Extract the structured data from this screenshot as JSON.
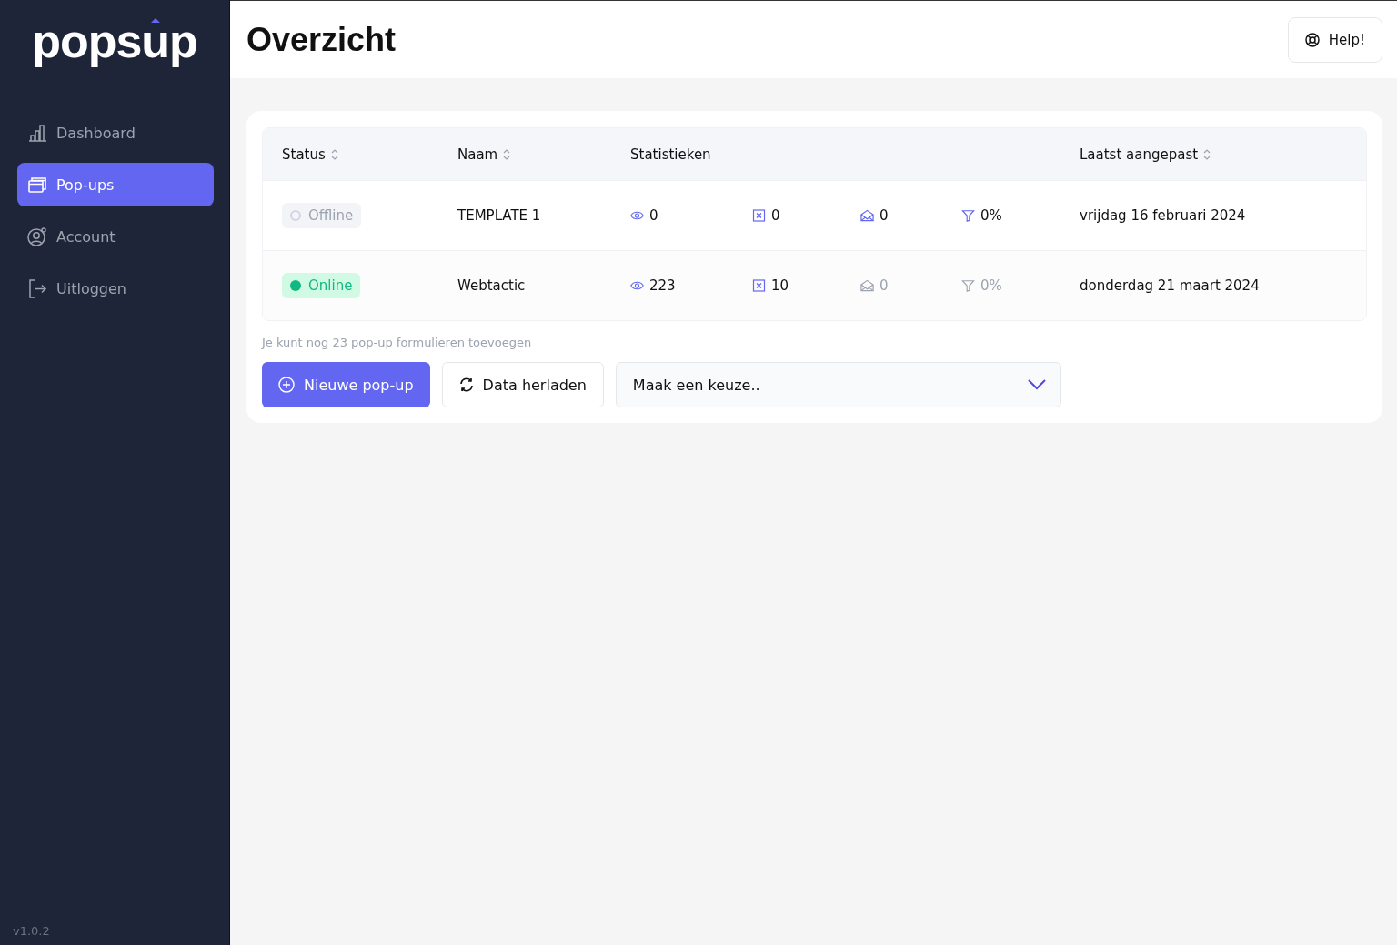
{
  "sidebar": {
    "logo": "popsup",
    "items": [
      {
        "label": "Dashboard",
        "selected": false
      },
      {
        "label": "Pop-ups",
        "selected": true
      },
      {
        "label": "Account",
        "selected": false
      },
      {
        "label": "Uitloggen",
        "selected": false
      }
    ],
    "version": "v1.0.2"
  },
  "header": {
    "title": "Overzicht",
    "help_button": "Help!"
  },
  "table": {
    "columns": [
      {
        "label": "Status",
        "sortable": true
      },
      {
        "label": "Naam",
        "sortable": true
      },
      {
        "label": "Statistieken",
        "sortable": false
      },
      {
        "label": "Laatst aangepast",
        "sortable": true
      }
    ],
    "rows": [
      {
        "status": "Offline",
        "online": false,
        "name": "TEMPLATE 1",
        "stats": [
          {
            "kind": "views",
            "value": "0",
            "active": true
          },
          {
            "kind": "closes",
            "value": "0",
            "active": true
          },
          {
            "kind": "conversions",
            "value": "0",
            "active": true
          },
          {
            "kind": "rate",
            "value": "0%",
            "active": true
          }
        ],
        "modified": "vrijdag 16 februari 2024"
      },
      {
        "status": "Online",
        "online": true,
        "name": "Webtactic",
        "stats": [
          {
            "kind": "views",
            "value": "223",
            "active": true
          },
          {
            "kind": "closes",
            "value": "10",
            "active": true
          },
          {
            "kind": "conversions",
            "value": "0",
            "active": false
          },
          {
            "kind": "rate",
            "value": "0%",
            "active": false
          }
        ],
        "modified": "donderdag 21 maart 2024"
      }
    ]
  },
  "note": "Je kunt nog 23 pop-up formulieren toevoegen",
  "actions": {
    "new_button": "Nieuwe pop-up",
    "reload_button": "Data herladen",
    "select": {
      "placeholder": "Maak een keuze.."
    }
  }
}
